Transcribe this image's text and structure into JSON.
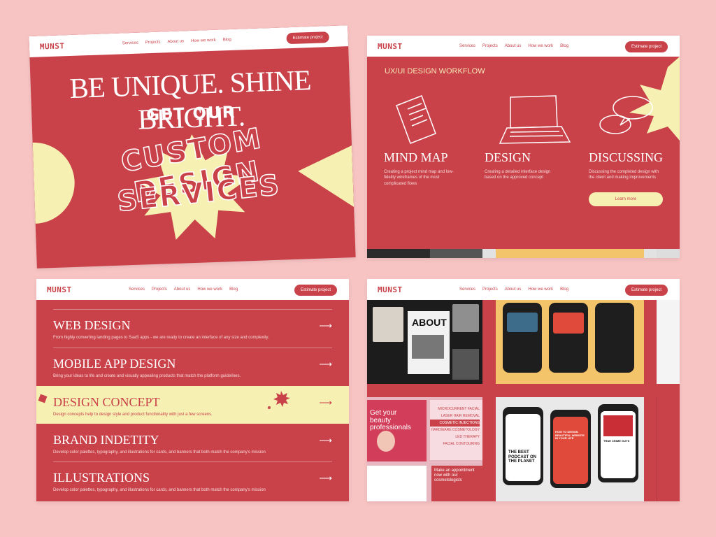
{
  "common": {
    "logo": "MUNST",
    "nav": [
      "Services",
      "Projects",
      "About us",
      "How we work",
      "Blog"
    ],
    "cta": "Estimate project"
  },
  "hero": {
    "headline": "BE UNIQUE. SHINE BRIGHT.",
    "sub": "GET OUR",
    "custom": "CUSTOM DESIGN",
    "services": "SERVICES"
  },
  "workflow": {
    "title": "UX/UI DESIGN WORKFLOW",
    "steps": [
      {
        "title": "MIND MAP",
        "desc": "Creating a project mind map and low-fidelity wireframes of the most complicated flows"
      },
      {
        "title": "DESIGN",
        "desc": "Creating a detailed interface design based on the approved concept"
      },
      {
        "title": "DISCUSSING",
        "desc": "Discussing the completed design with the client and making improvements"
      }
    ],
    "learn_more": "Learn more"
  },
  "services_list": [
    {
      "title": "WEB DESIGN",
      "desc": "From highly converting landing pages to SaaS apps - we are ready to create an interface of any size and complexity."
    },
    {
      "title": "MOBILE APP DESIGN",
      "desc": "Bring your ideas to life and create and visually appealing products that match the platform guidelines."
    },
    {
      "title": "DESIGN CONCEPT",
      "desc": "Design concepts help to design style and product functionality with just a few screens."
    },
    {
      "title": "BRAND INDETITY",
      "desc": "Develop color palettes, typography, and illustrations for cards, and banners that both match the company's mission"
    },
    {
      "title": "ILLUSTRATIONS",
      "desc": "Develop color palettes, typography, and illustrations for cards, and banners that both match the company's mission"
    }
  ],
  "portfolio": {
    "about": "ABOUT",
    "beauty": "Get your beauty professionals",
    "appointment": "Make an appointment now with our cosmetologists",
    "menu": [
      "MICROCURRENT FACIAL",
      "LASER HAIR REMOVAL",
      "COSMETIC INJECTIONS",
      "HARDWARE COSMETOLOGY",
      "LED THERAPY",
      "FACIAL CONTOURING"
    ],
    "podcast": "THE BEST PODCAST ON THE PLANET",
    "podcast2": "HOW TO DESIGN BEAUTIFUL WEBSITE IN YOUR LIFE",
    "crime": "TRUE CRIME GUYS"
  },
  "colors": {
    "brand": "#c9424a",
    "cream": "#f6f0b3",
    "bg": "#f7c3c3"
  }
}
